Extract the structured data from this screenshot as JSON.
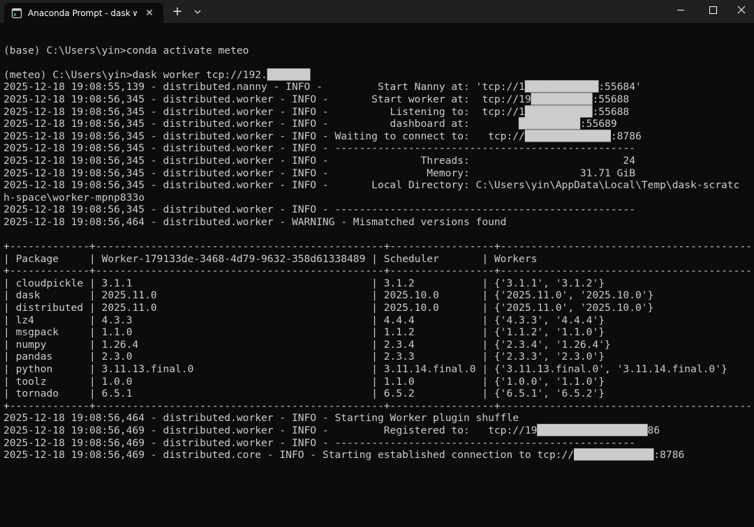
{
  "window": {
    "tab_title": "Anaconda Prompt - dask worker tcp://",
    "tab_close": "✕",
    "new_tab": "+",
    "icons": {
      "tab": "terminal-icon",
      "close": "close-icon",
      "dropdown": "chevron-down-icon",
      "minimize": "minimize-icon",
      "maximize": "maximize-icon",
      "window_close": "window-close-icon"
    }
  },
  "console": {
    "lines": [
      "",
      "(base) C:\\Users\\yin>conda activate meteo",
      "",
      "(meteo) C:\\Users\\yin>dask worker tcp://192.███████",
      "2025-12-18 19:08:55,139 - distributed.nanny - INFO -         Start Nanny at: 'tcp://1████████████:55684'",
      "2025-12-18 19:08:56,345 - distributed.worker - INFO -       Start worker at:  tcp://19██████████:55688",
      "2025-12-18 19:08:56,345 - distributed.worker - INFO -          Listening to:  tcp://1███████████:55688",
      "2025-12-18 19:08:56,345 - distributed.worker - INFO -          dashboard at:        ██████████:55689",
      "2025-12-18 19:08:56,345 - distributed.worker - INFO - Waiting to connect to:   tcp://██████████████:8786",
      "2025-12-18 19:08:56,345 - distributed.worker - INFO - -------------------------------------------------",
      "2025-12-18 19:08:56,345 - distributed.worker - INFO -               Threads:                         24",
      "2025-12-18 19:08:56,345 - distributed.worker - INFO -                Memory:                  31.71 GiB",
      "2025-12-18 19:08:56,345 - distributed.worker - INFO -       Local Directory: C:\\Users\\yin\\AppData\\Local\\Temp\\dask-scratc",
      "h-space\\worker-mpnp833o",
      "2025-12-18 19:08:56,345 - distributed.worker - INFO - -------------------------------------------------",
      "2025-12-18 19:08:56,464 - distributed.worker - WARNING - Mismatched versions found",
      "",
      "+-------------+-----------------------------------------------+-----------------+-------------------------------------------+",
      "| Package     | Worker-179133de-3468-4d79-9632-358d61338489 | Scheduler       | Workers                                   |",
      "+-------------+-----------------------------------------------+-----------------+-------------------------------------------+",
      "| cloudpickle | 3.1.1                                       | 3.1.2           | {'3.1.1', '3.1.2'}                        |",
      "| dask        | 2025.11.0                                   | 2025.10.0       | {'2025.11.0', '2025.10.0'}                |",
      "| distributed | 2025.11.0                                   | 2025.10.0       | {'2025.11.0', '2025.10.0'}                |",
      "| lz4         | 4.3.3                                       | 4.4.4           | {'4.3.3', '4.4.4'}                        |",
      "| msgpack     | 1.1.0                                       | 1.1.2           | {'1.1.2', '1.1.0'}                        |",
      "| numpy       | 1.26.4                                      | 2.3.4           | {'2.3.4', '1.26.4'}                       |",
      "| pandas      | 2.3.0                                       | 2.3.3           | {'2.3.3', '2.3.0'}                        |",
      "| python      | 3.11.13.final.0                             | 3.11.14.final.0 | {'3.11.13.final.0', '3.11.14.final.0'}    |",
      "| toolz       | 1.0.0                                       | 1.1.0           | {'1.0.0', '1.1.0'}                        |",
      "| tornado     | 6.5.1                                       | 6.5.2           | {'6.5.1', '6.5.2'}                        |",
      "+-------------+-----------------------------------------------+-----------------+-------------------------------------------+",
      "2025-12-18 19:08:56,464 - distributed.worker - INFO - Starting Worker plugin shuffle",
      "2025-12-18 19:08:56,469 - distributed.worker - INFO -         Registered to:   tcp://19██████████████████86",
      "2025-12-18 19:08:56,469 - distributed.worker - INFO - -------------------------------------------------",
      "2025-12-18 19:08:56,469 - distributed.core - INFO - Starting established connection to tcp://█████████████:8786"
    ]
  }
}
